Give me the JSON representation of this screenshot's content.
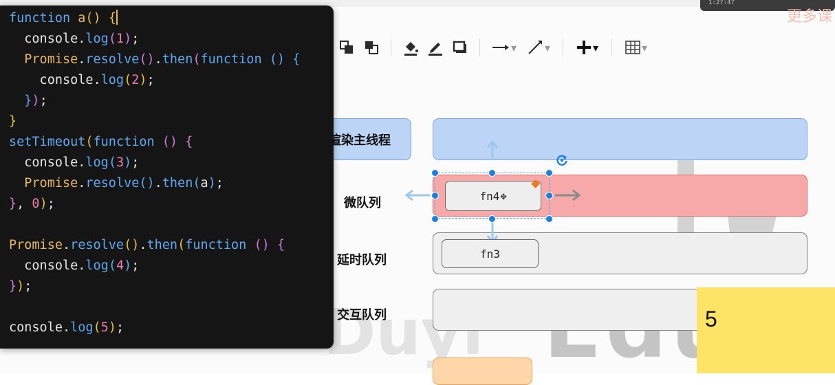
{
  "player": {
    "time": "1:27:47"
  },
  "brand_corner": "更多课",
  "toolbar": {
    "tools": [
      {
        "name": "bring-front-icon"
      },
      {
        "name": "send-back-icon"
      },
      {
        "name": "fill-color-icon"
      },
      {
        "name": "line-color-icon"
      },
      {
        "name": "shadow-icon"
      },
      {
        "name": "arrow-style-icon"
      },
      {
        "name": "connector-icon"
      },
      {
        "name": "insert-plus-icon"
      },
      {
        "name": "table-icon"
      }
    ]
  },
  "diagram": {
    "labels": {
      "render_thread": "渲染主线程",
      "micro_queue": "微队列",
      "delay_queue": "延时队列",
      "interaction_queue": "交互队列"
    },
    "tasks": {
      "fn4": "fn4",
      "fn3": "fn3"
    },
    "sticky_note": "5",
    "colors": {
      "render": "#bcd5f7",
      "micro": "#f7a9a9",
      "delay": "#efefef",
      "selection": "#1f7fe0"
    }
  },
  "watermark": {
    "text": "Educati",
    "text2": "Duyi"
  },
  "editor": {
    "lines": [
      [
        [
          "kw",
          "function"
        ],
        [
          "ws",
          " "
        ],
        [
          "fn",
          "a"
        ],
        [
          "br1",
          "()"
        ],
        [
          "ws",
          " "
        ],
        [
          "br1",
          "{"
        ],
        [
          "cursor",
          ""
        ]
      ],
      [
        [
          "ws",
          "  console."
        ],
        [
          "kw",
          "log"
        ],
        [
          "br2",
          "("
        ],
        [
          "num",
          "1"
        ],
        [
          "br2",
          ")"
        ],
        [
          "ws",
          ";"
        ]
      ],
      [
        [
          "ws",
          "  "
        ],
        [
          "fn",
          "Promise"
        ],
        [
          "ws",
          "."
        ],
        [
          "kw",
          "resolve"
        ],
        [
          "br2",
          "()"
        ],
        [
          "ws",
          "."
        ],
        [
          "kw",
          "then"
        ],
        [
          "br2",
          "("
        ],
        [
          "kw",
          "function"
        ],
        [
          "ws",
          " "
        ],
        [
          "br3",
          "()"
        ],
        [
          "ws",
          " "
        ],
        [
          "br3",
          "{"
        ]
      ],
      [
        [
          "ws",
          "    console."
        ],
        [
          "kw",
          "log"
        ],
        [
          "br1",
          "("
        ],
        [
          "num",
          "2"
        ],
        [
          "br1",
          ")"
        ],
        [
          "ws",
          ";"
        ]
      ],
      [
        [
          "ws",
          "  "
        ],
        [
          "br3",
          "}"
        ],
        [
          "br2",
          ")"
        ],
        [
          "ws",
          ";"
        ]
      ],
      [
        [
          "br1",
          "}"
        ]
      ],
      [
        [
          "kw",
          "setTimeout"
        ],
        [
          "br1",
          "("
        ],
        [
          "kw",
          "function"
        ],
        [
          "ws",
          " "
        ],
        [
          "br2",
          "()"
        ],
        [
          "ws",
          " "
        ],
        [
          "br2",
          "{"
        ]
      ],
      [
        [
          "ws",
          "  console."
        ],
        [
          "kw",
          "log"
        ],
        [
          "br3",
          "("
        ],
        [
          "num",
          "3"
        ],
        [
          "br3",
          ")"
        ],
        [
          "ws",
          ";"
        ]
      ],
      [
        [
          "ws",
          "  "
        ],
        [
          "fn",
          "Promise"
        ],
        [
          "ws",
          "."
        ],
        [
          "kw",
          "resolve"
        ],
        [
          "br3",
          "()"
        ],
        [
          "ws",
          "."
        ],
        [
          "kw",
          "then"
        ],
        [
          "br3",
          "("
        ],
        [
          "ws",
          "a"
        ],
        [
          "br3",
          ")"
        ],
        [
          "ws",
          ";"
        ]
      ],
      [
        [
          "br2",
          "}"
        ],
        [
          "ws",
          ", "
        ],
        [
          "num",
          "0"
        ],
        [
          "br1",
          ")"
        ],
        [
          "ws",
          ";"
        ]
      ],
      [],
      [
        [
          "fn",
          "Promise"
        ],
        [
          "ws",
          "."
        ],
        [
          "kw",
          "resolve"
        ],
        [
          "br1",
          "()"
        ],
        [
          "ws",
          "."
        ],
        [
          "kw",
          "then"
        ],
        [
          "br1",
          "("
        ],
        [
          "kw",
          "function"
        ],
        [
          "ws",
          " "
        ],
        [
          "br2",
          "()"
        ],
        [
          "ws",
          " "
        ],
        [
          "br2",
          "{"
        ]
      ],
      [
        [
          "ws",
          "  console."
        ],
        [
          "kw",
          "log"
        ],
        [
          "br3",
          "("
        ],
        [
          "num",
          "4"
        ],
        [
          "br3",
          ")"
        ],
        [
          "ws",
          ";"
        ]
      ],
      [
        [
          "br2",
          "}"
        ],
        [
          "br1",
          ")"
        ],
        [
          "ws",
          ";"
        ]
      ],
      [],
      [
        [
          "ws",
          "console."
        ],
        [
          "kw",
          "log"
        ],
        [
          "br1",
          "("
        ],
        [
          "num",
          "5"
        ],
        [
          "br1",
          ")"
        ],
        [
          "ws",
          ";"
        ]
      ]
    ]
  }
}
